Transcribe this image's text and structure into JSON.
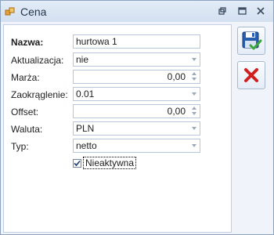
{
  "window": {
    "title": "Cena"
  },
  "form": {
    "fields": [
      {
        "label": "Nazwa:",
        "value": "hurtowa 1"
      },
      {
        "label": "Aktualizacja:",
        "value": "nie"
      },
      {
        "label": "Marża:",
        "value": "0,00"
      },
      {
        "label": "Zaokrąglenie:",
        "value": "0.01"
      },
      {
        "label": "Offset:",
        "value": "0,00"
      },
      {
        "label": "Waluta:",
        "value": "PLN"
      },
      {
        "label": "Typ:",
        "value": "netto"
      }
    ],
    "inactive": {
      "label": "Nieaktywna",
      "checked": true
    }
  },
  "icons": {
    "app": "price-tag-icon",
    "save": "floppy-disk-check-icon",
    "cancel": "red-x-icon"
  },
  "colors": {
    "accent": "#2a5fb0",
    "check": "#3ca63c",
    "cancel": "#d21e1e"
  }
}
